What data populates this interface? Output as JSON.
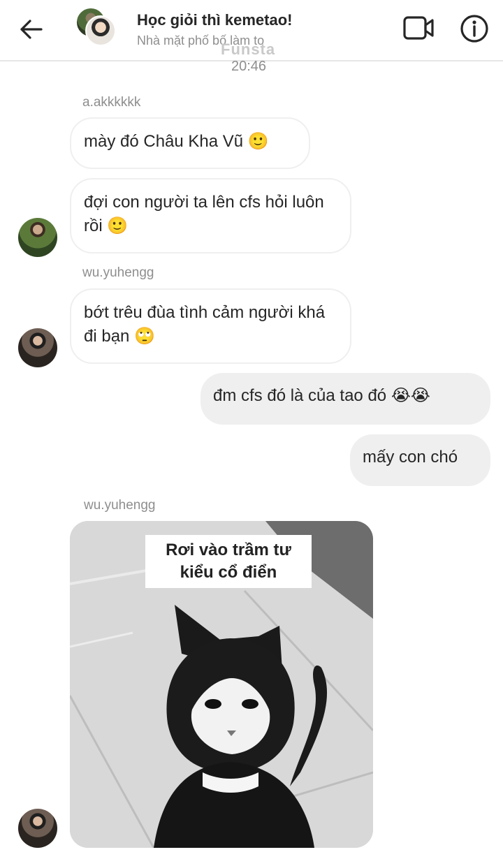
{
  "header": {
    "title": "Học giỏi thì kemetao!",
    "subtitle": "Nhà mặt phố bố làm to",
    "watermark": "Funsta",
    "back_icon": "arrow-left-icon",
    "video_icon": "video-camera-icon",
    "info_icon": "info-circle-icon"
  },
  "timestamp": "20:46",
  "messages": [
    {
      "sender": "a.akkkkkk",
      "text": "mày đó Châu Kha Vũ 🙂"
    },
    {
      "text": "đợi con người ta lên cfs hỏi luôn rồi 🙂"
    },
    {
      "sender": "wu.yuhengg",
      "text": "bớt trêu đùa tình cảm người khá đi bạn 🙄"
    },
    {
      "text": "đm cfs đó là của tao đó 😭😭"
    },
    {
      "text": "mấy con chó"
    },
    {
      "sender": "wu.yuhengg",
      "image_caption": "Rơi vào trầm tư kiểu cổ điển"
    }
  ],
  "colors": {
    "incoming_bubble": "#ffffff",
    "outgoing_bubble": "#efefef",
    "secondary_text": "#8e8e8e"
  }
}
